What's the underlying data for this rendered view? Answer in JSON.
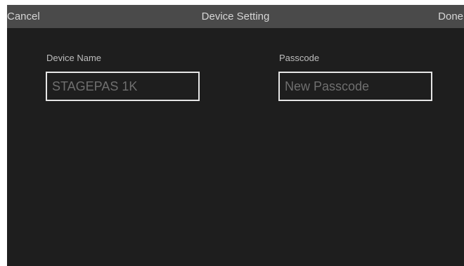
{
  "navbar": {
    "cancel_label": "Cancel",
    "title": "Device Setting",
    "done_label": "Done"
  },
  "form": {
    "device_name": {
      "label": "Device Name",
      "value": "STAGEPAS 1K"
    },
    "passcode": {
      "label": "Passcode",
      "placeholder": "New Passcode"
    }
  },
  "colors": {
    "background": "#1e1e1e",
    "navbar": "#4a4a4a",
    "field_border": "#e6e6e6"
  }
}
